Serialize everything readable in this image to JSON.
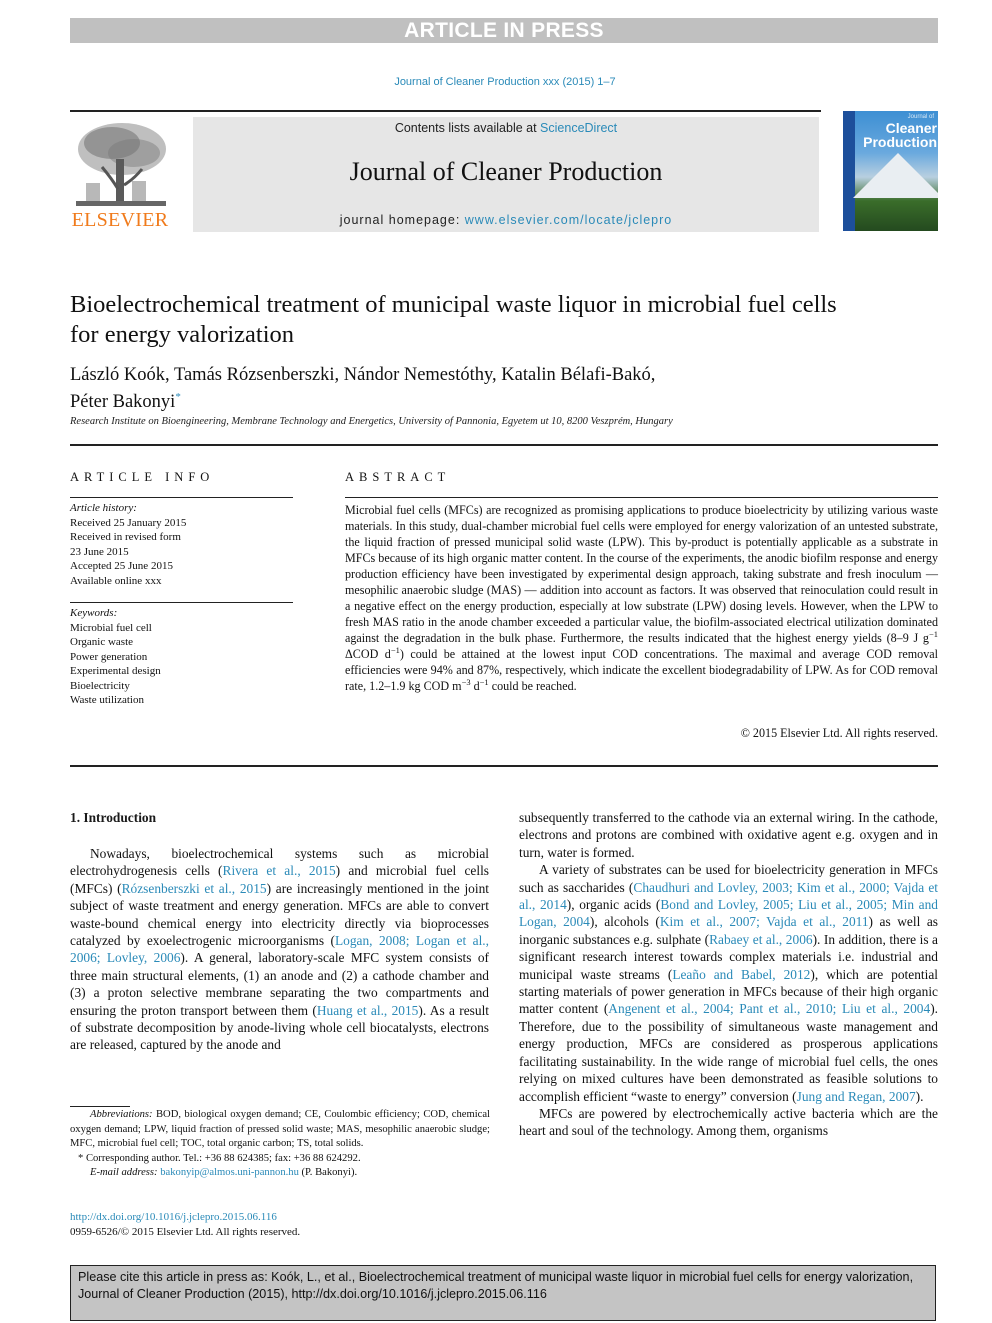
{
  "banner": "ARTICLE IN PRESS",
  "journal_ref": "Journal of Cleaner Production xxx (2015) 1–7",
  "header": {
    "publisher_logo": "elsevier-tree-logo",
    "publisher_name": "ELSEVIER",
    "contents_prefix": "Contents lists available at ",
    "contents_link": "ScienceDirect",
    "journal_name": "Journal of Cleaner Production",
    "homepage_prefix": "journal homepage: ",
    "homepage_link": "www.elsevier.com/locate/jclepro",
    "cover_title_line1": "Cleaner",
    "cover_title_line2": "Production",
    "cover_small": "Journal of"
  },
  "article": {
    "title": "Bioelectrochemical treatment of municipal waste liquor in microbial fuel cells for energy valorization",
    "authors_line1": "László Koók, Tamás Rózsenberszki, Nándor Nemestóthy, Katalin Bélafi-Bakó,",
    "authors_line2": "Péter Bakonyi",
    "corresponding_mark": "*",
    "affiliation": "Research Institute on Bioengineering, Membrane Technology and Energetics, University of Pannonia, Egyetem ut 10, 8200 Veszprém, Hungary"
  },
  "article_info": {
    "heading": "ARTICLE INFO",
    "history_label": "Article history:",
    "history": [
      "Received 25 January 2015",
      "Received in revised form",
      "23 June 2015",
      "Accepted 25 June 2015",
      "Available online xxx"
    ],
    "keywords_label": "Keywords:",
    "keywords": [
      "Microbial fuel cell",
      "Organic waste",
      "Power generation",
      "Experimental design",
      "Bioelectricity",
      "Waste utilization"
    ]
  },
  "abstract": {
    "heading": "ABSTRACT",
    "part1": "Microbial fuel cells (MFCs) are recognized as promising applications to produce bioelectricity by utilizing various waste materials. In this study, dual-chamber microbial fuel cells were employed for energy valorization of an untested substrate, the liquid fraction of pressed municipal solid waste (LPW). This by-product is potentially applicable as a substrate in MFCs because of its high organic matter content. In the course of the experiments, the anodic biofilm response and energy production efficiency have been investigated by experimental design approach, taking substrate and fresh inoculum — mesophilic anaerobic sludge (MAS) — addition into account as factors. It was observed that reinoculation could result in a negative effect on the energy production, especially at low substrate (LPW) dosing levels. However, when the LPW to fresh MAS ratio in the anode chamber exceeded a particular value, the biofilm-associated electrical utilization dominated against the degradation in the bulk phase. Furthermore, the results indicated that the highest energy yields (8–9 J g",
    "sup1": "−1",
    "part2": " ΔCOD d",
    "sup2": "−1",
    "part3": ") could be attained at the lowest input COD concentrations. The maximal and average COD removal efficiencies were 94% and 87%, respectively, which indicate the excellent biodegradability of LPW. As for COD removal rate, 1.2–1.9 kg COD m",
    "sup3": "−3",
    "part4": " d",
    "sup4": "−1",
    "part5": " could be reached.",
    "copyright": "© 2015 Elsevier Ltd. All rights reserved."
  },
  "intro": {
    "heading": "1.  Introduction",
    "left_p1": [
      {
        "t": "Nowadays, bioelectrochemical systems such as microbial electrohydrogenesis cells ("
      },
      {
        "t": "Rivera et al., 2015",
        "link": true
      },
      {
        "t": ") and microbial fuel cells (MFCs) ("
      },
      {
        "t": "Rózsenberszki et al., 2015",
        "link": true
      },
      {
        "t": ") are increasingly mentioned in the joint subject of waste treatment and energy generation. MFCs are able to convert waste-bound chemical energy into electricity directly via bioprocesses catalyzed by exoelectrogenic microorganisms ("
      },
      {
        "t": "Logan, 2008; Logan et al., 2006; Lovley, 2006",
        "link": true
      },
      {
        "t": "). A general, laboratory-scale MFC system consists of three main structural elements, (1) an anode and (2) a cathode chamber and (3) a proton selective membrane separating the two compartments and ensuring the proton transport between them ("
      },
      {
        "t": "Huang et al., 2015",
        "link": true
      },
      {
        "t": "). As a result of substrate decomposition by anode-living whole cell biocatalysts, electrons are released, captured by the anode and"
      }
    ],
    "right_p0": [
      {
        "t": "subsequently transferred to the cathode via an external wiring. In the cathode, electrons and protons are combined with oxidative agent e.g. oxygen and in turn, water is formed."
      }
    ],
    "right_p1": [
      {
        "t": "A variety of substrates can be used for bioelectricity generation in MFCs such as saccharides ("
      },
      {
        "t": "Chaudhuri and Lovley, 2003; Kim et al., 2000; Vajda et al., 2014",
        "link": true
      },
      {
        "t": "), organic acids ("
      },
      {
        "t": "Bond and Lovley, 2005; Liu et al., 2005; Min and Logan, 2004",
        "link": true
      },
      {
        "t": "), alcohols ("
      },
      {
        "t": "Kim et al., 2007; Vajda et al., 2011",
        "link": true
      },
      {
        "t": ") as well as inorganic substances e.g. sulphate ("
      },
      {
        "t": "Rabaey et al., 2006",
        "link": true
      },
      {
        "t": "). In addition, there is a significant research interest towards complex materials i.e. industrial and municipal waste streams ("
      },
      {
        "t": "Leaño and Babel, 2012",
        "link": true
      },
      {
        "t": "), which are potential starting materials of power generation in MFCs because of their high organic matter content ("
      },
      {
        "t": "Angenent et al., 2004; Pant et al., 2010; Liu et al., 2004",
        "link": true
      },
      {
        "t": "). Therefore, due to the possibility of simultaneous waste management and energy production, MFCs are considered as prosperous applications facilitating sustainability. In the wide range of microbial fuel cells, the ones relying on mixed cultures have been demonstrated as feasible solutions to accomplish efficient “waste to energy” conversion ("
      },
      {
        "t": "Jung and Regan, 2007",
        "link": true
      },
      {
        "t": ")."
      }
    ],
    "right_p2": [
      {
        "t": "MFCs are powered by electrochemically active bacteria which are the heart and soul of the technology. Among them, organisms"
      }
    ]
  },
  "footnotes": {
    "abbr_label": "Abbreviations:",
    "abbr_text": " BOD, biological oxygen demand; CE, Coulombic efficiency; COD, chemical oxygen demand; LPW, liquid fraction of pressed solid waste; MAS, mesophilic anaerobic sludge; MFC, microbial fuel cell; TOC, total organic carbon; TS, total solids.",
    "corresponding": "* Corresponding author. Tel.: +36 88 624385; fax: +36 88 624292.",
    "email_label": "E-mail address:",
    "email": "bakonyip@almos.uni-pannon.hu",
    "email_suffix": " (P. Bakonyi).",
    "doi": "http://dx.doi.org/10.1016/j.jclepro.2015.06.116",
    "issn": "0959-6526/© 2015 Elsevier Ltd. All rights reserved."
  },
  "cite_box": "Please cite this article in press as: Koók, L., et al., Bioelectrochemical treatment of municipal waste liquor in microbial fuel cells for energy valorization, Journal of Cleaner Production (2015), http://dx.doi.org/10.1016/j.jclepro.2015.06.116",
  "colors": {
    "link": "#2a8ab8",
    "elsevier_orange": "#f07b1c",
    "banner_gray": "#c0c0c0",
    "header_gray": "#e6e6e6",
    "cite_gray": "#c4c4c4"
  }
}
